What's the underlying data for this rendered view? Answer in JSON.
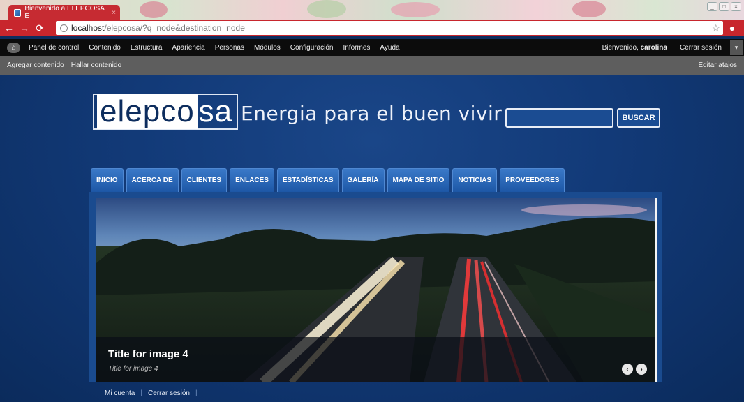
{
  "browser": {
    "tab_title": "Bienvenido a ELEPCOSA | E",
    "tab_close": "×",
    "url_host": "localhost",
    "url_path": "/elepcosa/?q=node&destination=node",
    "back_icon": "arrow-left-icon",
    "forward_icon": "arrow-right-icon",
    "reload_icon": "reload-icon",
    "star_icon": "star-icon",
    "accent": "#c8262d"
  },
  "admin": {
    "menu": [
      "Panel de control",
      "Contenido",
      "Estructura",
      "Apariencia",
      "Personas",
      "Módulos",
      "Configuración",
      "Informes",
      "Ayuda"
    ],
    "welcome_prefix": "Bienvenido,",
    "username": "carolina",
    "logout": "Cerrar sesión",
    "shortcuts": [
      "Agregar contenido",
      "Hallar contenido"
    ],
    "edit_shortcuts": "Editar atajos"
  },
  "site": {
    "logo_part1": "elepco",
    "logo_part2": "sa",
    "tagline": "Energia para el buen vivir",
    "search_value": "",
    "search_button": "BUSCAR",
    "nav": [
      "INICIO",
      "ACERCA DE",
      "CLIENTES",
      "ENLACES",
      "ESTADÍSTICAS",
      "GALERÍA",
      "MAPA DE SITIO",
      "NOTICIAS",
      "PROVEEDORES"
    ]
  },
  "slideshow": {
    "title": "Title for image 4",
    "subtitle": "Title for image 4",
    "prev": "‹",
    "next": "›"
  },
  "footer": {
    "links": [
      "Mi cuenta",
      "Cerrar sesión"
    ]
  }
}
